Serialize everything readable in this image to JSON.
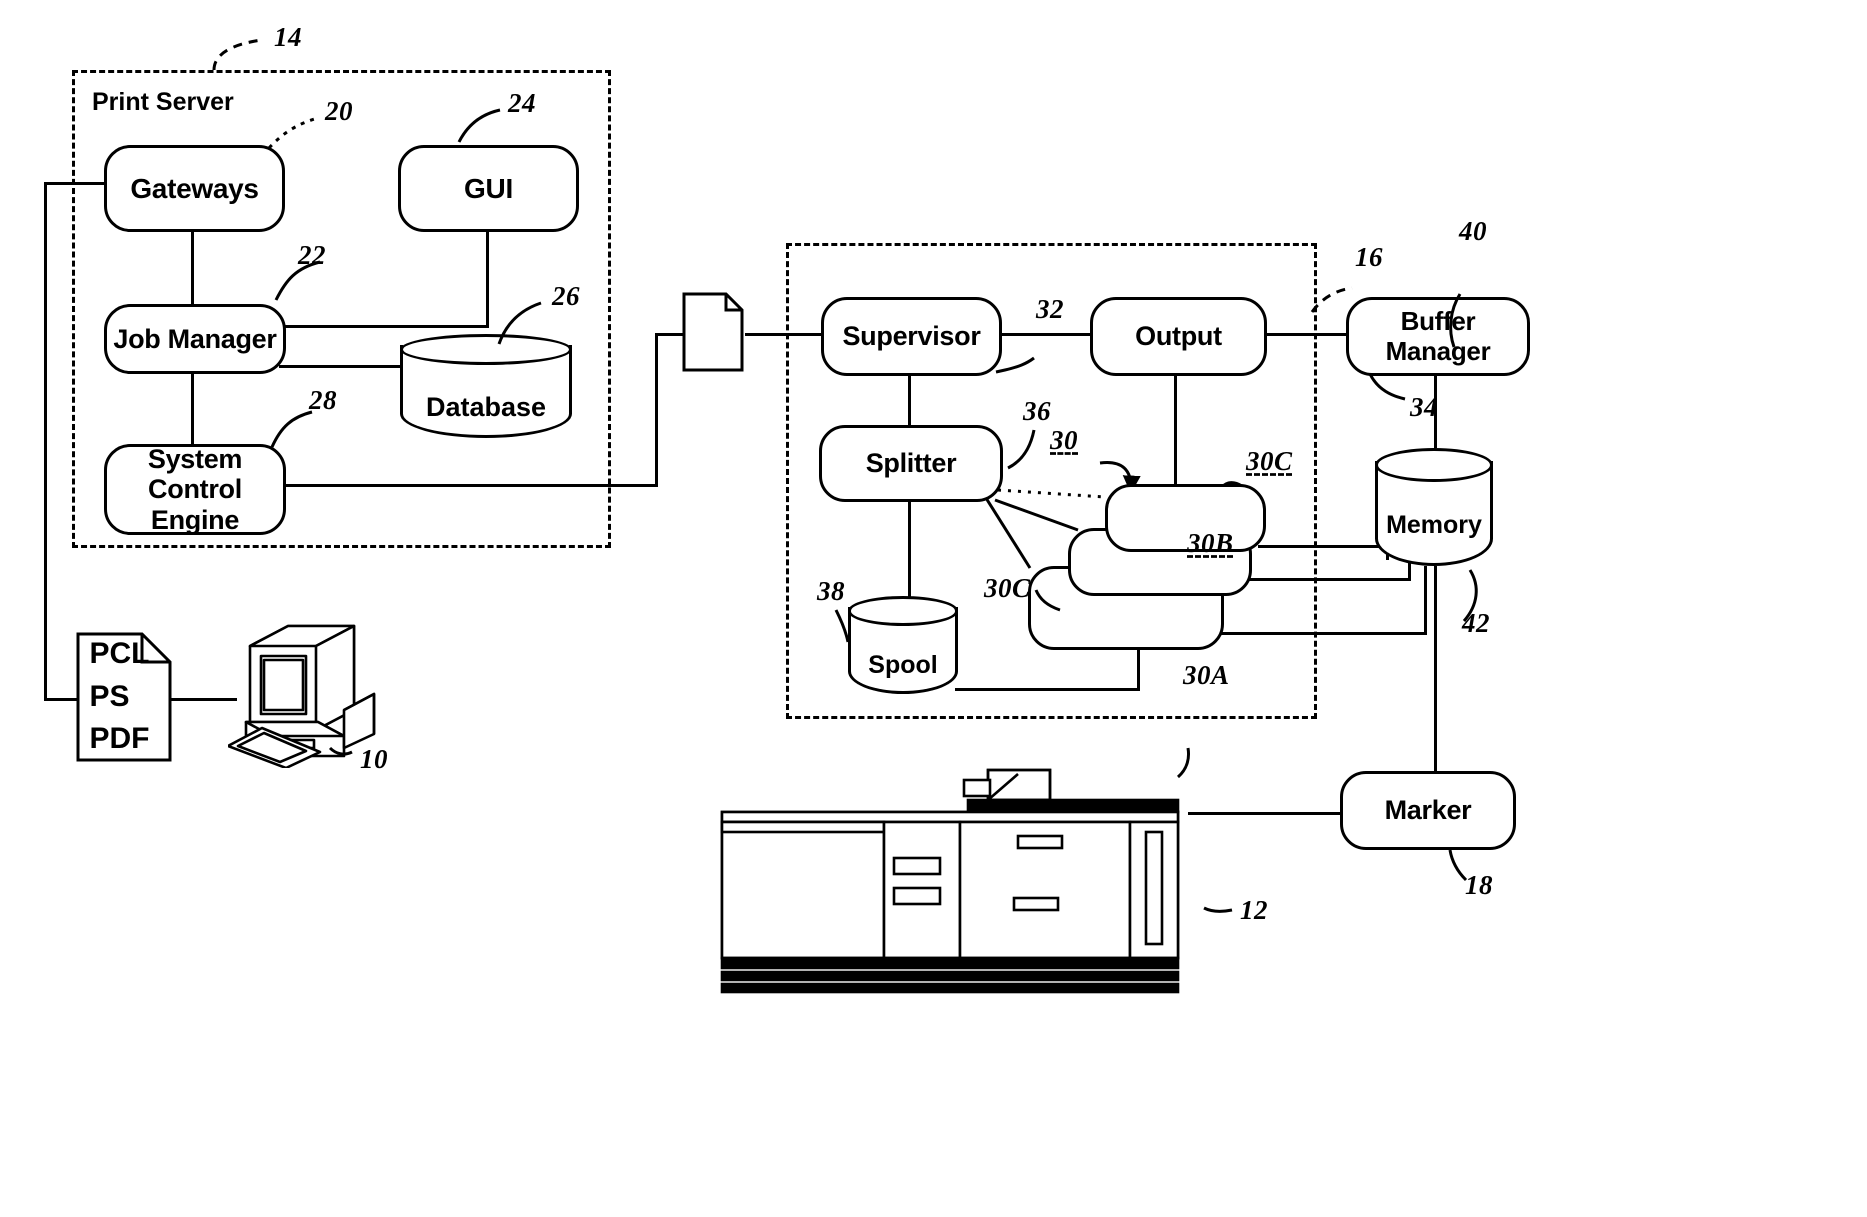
{
  "figure": {
    "domain": "patent-block-diagram",
    "title": "Print server and print engine block diagram"
  },
  "groups": [
    {
      "name": "print-server",
      "caption": "Print Server",
      "ref": "14"
    },
    {
      "name": "print-engine",
      "caption": "",
      "ref": "16"
    }
  ],
  "boxes": {
    "gateways": {
      "label": "Gateways",
      "ref": "20"
    },
    "gui": {
      "label": "GUI",
      "ref": "24"
    },
    "job_manager": {
      "label": "Job Manager",
      "ref": "22"
    },
    "system_control": {
      "label": "System Control\nEngine",
      "line1": "System Control",
      "line2": "Engine",
      "ref": "28"
    },
    "supervisor": {
      "label": "Supervisor",
      "ref": "32"
    },
    "output": {
      "label": "Output",
      "ref": "34"
    },
    "buffer_manager": {
      "label": "Buffer Manager",
      "ref": "40"
    },
    "splitter": {
      "label": "Splitter",
      "ref": "36"
    },
    "marker": {
      "label": "Marker",
      "ref": "18"
    },
    "raster_c": {
      "label": "",
      "ref": "30C"
    },
    "raster_b": {
      "label": "",
      "ref": "30B"
    },
    "raster_a": {
      "label": "",
      "ref": "30A"
    }
  },
  "cylinders": {
    "database": {
      "label": "Database",
      "ref": "26"
    },
    "spool": {
      "label": "Spool",
      "ref": "38"
    },
    "memory": {
      "label": "Memory",
      "ref": "42"
    }
  },
  "document": {
    "formats": [
      "PCL",
      "PS",
      "PDF"
    ]
  },
  "icons": {
    "workstation": {
      "name": "workstation-icon",
      "ref": "10"
    },
    "printer": {
      "name": "printer-icon",
      "ref": "12"
    },
    "job_page": {
      "name": "page-icon"
    }
  },
  "refs": {
    "r10": "10",
    "r12": "12",
    "r14": "14",
    "r16": "16",
    "r18": "18",
    "r20": "20",
    "r22": "22",
    "r24": "24",
    "r26": "26",
    "r28": "28",
    "r30": "30",
    "r30a": "30A",
    "r30b": "30B",
    "r30c_top": "30C",
    "r30c_bottom": "30C",
    "r32": "32",
    "r34": "34",
    "r36": "36",
    "r38": "38",
    "r40": "40",
    "r42": "42"
  },
  "colors": {
    "ink": "#000000",
    "paper": "#ffffff"
  }
}
